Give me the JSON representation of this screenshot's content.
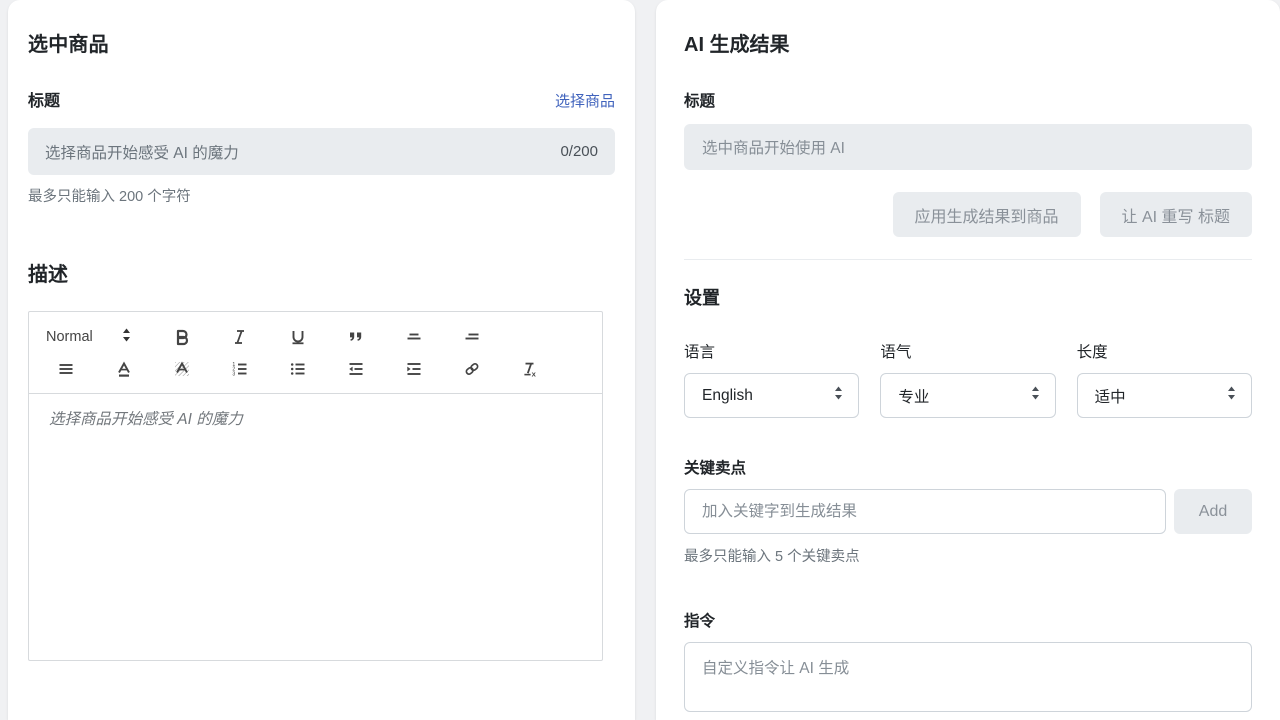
{
  "left_panel": {
    "title": "选中商品",
    "title_field": {
      "label": "标题",
      "select_product_link": "选择商品",
      "placeholder": "选择商品开始感受 AI 的魔力",
      "counter": "0/200",
      "help": "最多只能输入 200 个字符"
    },
    "description": {
      "heading": "描述",
      "toolbar": {
        "format_picker": "Normal",
        "buttons_row1": [
          "bold-icon",
          "italic-icon",
          "underline-icon",
          "blockquote-icon",
          "align-center-icon",
          "align-right-icon"
        ],
        "buttons_row2": [
          "align-justify-icon",
          "font-color-icon",
          "background-color-icon",
          "ordered-list-icon",
          "bullet-list-icon",
          "outdent-icon",
          "indent-icon",
          "link-icon",
          "clear-format-icon"
        ]
      },
      "placeholder": "选择商品开始感受 AI 的魔力"
    }
  },
  "right_panel": {
    "title": "AI 生成结果",
    "result_title": {
      "label": "标题",
      "placeholder": "选中商品开始使用 AI"
    },
    "actions": {
      "apply": "应用生成结果到商品",
      "rewrite": "让 AI 重写 标题"
    },
    "settings": {
      "heading": "设置",
      "selects": [
        {
          "label": "语言",
          "value": "English"
        },
        {
          "label": "语气",
          "value": "专业"
        },
        {
          "label": "长度",
          "value": "适中"
        }
      ],
      "keywords": {
        "label": "关键卖点",
        "placeholder": "加入关键字到生成结果",
        "add_button": "Add",
        "help": "最多只能输入 5 个关键卖点"
      },
      "instruction": {
        "label": "指令",
        "placeholder": "自定义指令让 AI 生成"
      }
    }
  },
  "colors": {
    "link": "#4063bd",
    "page_bg": "#f0f1f3",
    "card_bg": "#ffffff",
    "disabled_bg": "#e9ecef",
    "muted_text": "#6c757d",
    "border": "#ced4da"
  }
}
